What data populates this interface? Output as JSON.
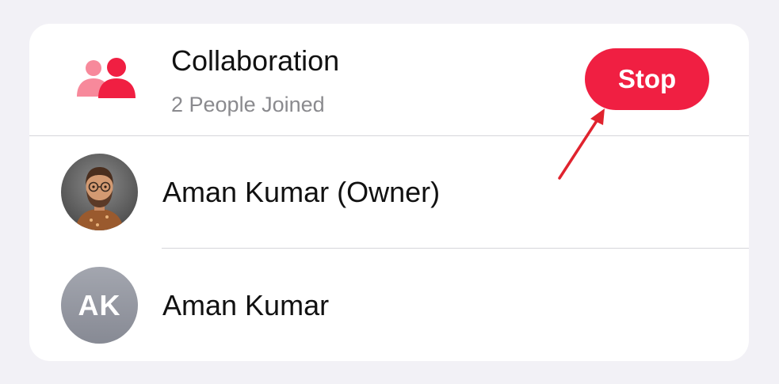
{
  "collaboration": {
    "title": "Collaboration",
    "subtitle": "2 People Joined",
    "icon": "people-icon",
    "stop_label": "Stop"
  },
  "participants": [
    {
      "name": "Aman Kumar (Owner)",
      "avatar": "memoji-avatar"
    },
    {
      "name": "Aman Kumar",
      "initials": "AK"
    }
  ],
  "colors": {
    "accent": "#F01F42",
    "icon_light": "#F7899B",
    "annotation_arrow": "#E0232E",
    "avatar_initials_bg": "#8F929C"
  }
}
